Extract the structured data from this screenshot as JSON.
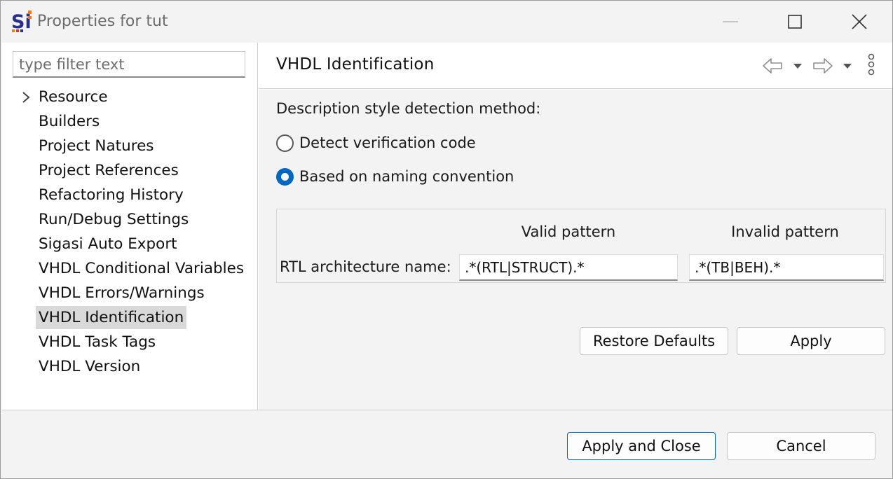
{
  "window": {
    "title": "Properties for tut"
  },
  "filter": {
    "placeholder": "type filter text"
  },
  "tree": {
    "items": [
      {
        "label": "Resource",
        "expandable": true
      },
      {
        "label": "Builders"
      },
      {
        "label": "Project Natures"
      },
      {
        "label": "Project References"
      },
      {
        "label": "Refactoring History"
      },
      {
        "label": "Run/Debug Settings"
      },
      {
        "label": "Sigasi Auto Export"
      },
      {
        "label": "VHDL Conditional Variables"
      },
      {
        "label": "VHDL Errors/Warnings"
      },
      {
        "label": "VHDL Identification",
        "selected": true
      },
      {
        "label": "VHDL Task Tags"
      },
      {
        "label": "VHDL Version"
      }
    ]
  },
  "page": {
    "title": "VHDL Identification",
    "detection_label": "Description style detection method:",
    "options": [
      {
        "label": "Detect verification code",
        "checked": false
      },
      {
        "label": "Based on naming convention",
        "checked": true
      }
    ],
    "valid_header": "Valid pattern",
    "invalid_header": "Invalid pattern",
    "row_label": "RTL architecture name:",
    "valid_value": ".*(RTL|STRUCT).*",
    "invalid_value": ".*(TB|BEH).*",
    "restore_label": "Restore Defaults",
    "apply_label": "Apply"
  },
  "footer": {
    "apply_close_label": "Apply and Close",
    "cancel_label": "Cancel"
  },
  "colors": {
    "accent": "#0067c0",
    "selection": "#d9d9d9",
    "logo_blue": "#2b2f8c",
    "logo_orange": "#f07a1a",
    "logo_red": "#d8323c"
  },
  "icons": {
    "app": "sigasi-logo-icon",
    "minimize": "minimize-icon",
    "maximize": "maximize-icon",
    "close": "close-icon",
    "back": "back-arrow-icon",
    "forward": "forward-arrow-icon",
    "menu": "more-vertical-icon"
  }
}
